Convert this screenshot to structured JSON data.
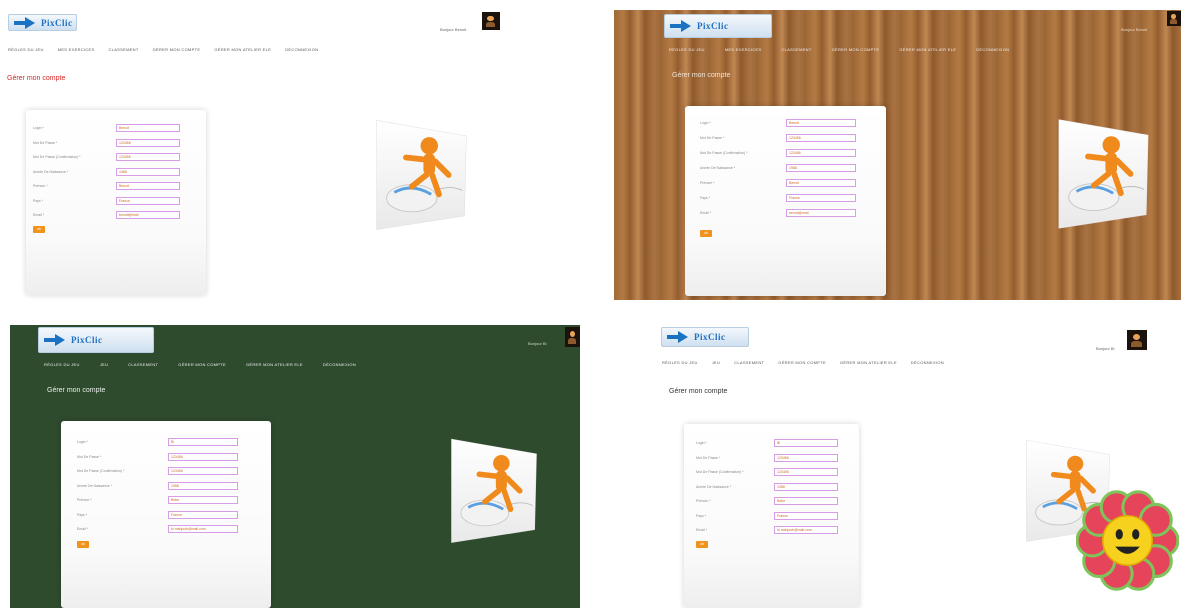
{
  "logo_word": "PixClic",
  "panels": [
    {
      "nav": [
        "RÈGLES DU JEU",
        "MES EXERCICES",
        "CLASSEMENT",
        "GÉRER MON COMPTE",
        "GÉRER MON ATELIER ELE",
        "DÉCONNEXION"
      ],
      "title": "Gérer mon compte",
      "title_color": "#d62828",
      "welcome": "Bonjour Benoit",
      "form": {
        "labels": [
          "Login *",
          "Mot De Passe *",
          "Mot De Passe (Confirmation) *",
          "Année De Naissance *",
          "Prénom *",
          "Pays *",
          "Email *"
        ],
        "values": [
          "Benoit",
          "123456",
          "123456",
          "1988",
          "Benoit",
          "France",
          "benoit@mail"
        ],
        "button": "ok"
      }
    },
    {
      "nav": [
        "RÈGLES DU JEU",
        "MES EXERCICES",
        "CLASSEMENT",
        "GÉRER MON COMPTE",
        "GÉRER MON ATELIER ELE",
        "DÉCONNEXION"
      ],
      "title": "Gérer mon compte",
      "title_color": "#f0e6d8",
      "welcome": "Bonjour Benoit",
      "form": {
        "labels": [
          "Login *",
          "Mot De Passe *",
          "Mot De Passe (Confirmation) *",
          "Année De Naissance *",
          "Prénom *",
          "Pays *",
          "Email *"
        ],
        "values": [
          "Benoit",
          "123456",
          "123456",
          "1988",
          "Benoit",
          "France",
          "benoit@mail"
        ],
        "button": "ok"
      }
    },
    {
      "nav": [
        "RÈGLES DU JEU",
        "JEU",
        "CLASSEMENT",
        "GÉRER MON COMPTE",
        "GÉRER MON ATELIER ELE",
        "DÉCONNEXION"
      ],
      "title": "Gérer mon compte",
      "title_color": "#e9efe9",
      "welcome": "Bonjour Bi",
      "form": {
        "labels": [
          "Login *",
          "Mot De Passe *",
          "Mot De Passe (Confirmation) *",
          "Année De Naissance *",
          "Prénom *",
          "Pays *",
          "Email *"
        ],
        "values": [
          "Bi",
          "123456",
          "123456",
          "1988",
          "Bebe",
          "France",
          "bi.mahjoub@mail.com"
        ],
        "button": "ok"
      }
    },
    {
      "nav": [
        "RÈGLES DU JEU",
        "JEU",
        "CLASSEMENT",
        "GÉRER MON COMPTE",
        "GÉRER MON ATELIER ELE",
        "DÉCONNEXION"
      ],
      "title": "Gérer mon compte",
      "title_color": "#333333",
      "welcome": "Bonjour Bi",
      "form": {
        "labels": [
          "Login *",
          "Mot De Passe *",
          "Mot De Passe (Confirmation) *",
          "Année De Naissance *",
          "Prénom *",
          "Pays *",
          "Email *"
        ],
        "values": [
          "Bi",
          "123456",
          "123456",
          "1988",
          "Bebe",
          "France",
          "bi.mahjoub@mail.com"
        ],
        "button": "ok"
      }
    }
  ],
  "icons": [
    "pixclic-logo-icon",
    "user-avatar-icon",
    "mouse-mascot-image",
    "smiling-flower-image"
  ]
}
